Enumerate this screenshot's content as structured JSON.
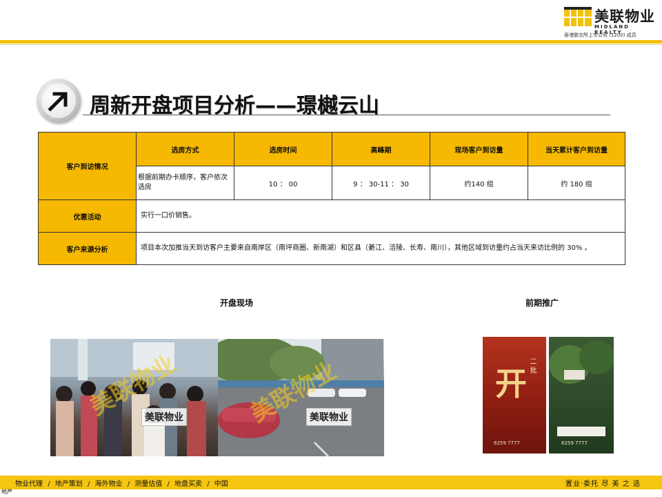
{
  "header": {
    "logo_cn": "美联物业",
    "logo_en": "MIDLAND REALTY",
    "logo_sub": "香港联交所上市公司 (1200) 成员",
    "brand_color": "#f6c510"
  },
  "title": "周新开盘项目分析——璟樾云山",
  "title_icon": "arrow-up-right-icon",
  "table": {
    "visits_label": "客户到访情况",
    "columns": [
      "选房方式",
      "选房时间",
      "高峰期",
      "现场客户到访量",
      "当天累计客户到访量"
    ],
    "values": [
      "根据前期办卡顺序，客户依次选房",
      "10 ： 00",
      "9 ： 30-11 ： 30",
      "约140 组",
      "约 180 组"
    ],
    "promo_label": "优惠活动",
    "promo_value": "实行一口价销售。",
    "source_label": "客户来源分析",
    "source_value": "项目本次加推当天到访客户主要来自南岸区（南坪商圈、新南湖）和区县（綦江、涪陵、长寿、南川），其他区域到访量约占当天来访比例的 30% 。"
  },
  "sections": {
    "opening_site": "开盘现场",
    "pre_promotion": "前期推广"
  },
  "photos": {
    "watermark": "美联物业",
    "poster_big_char": "开",
    "poster_side_text": "二 批",
    "poster_phone": "6259 7777"
  },
  "footer": {
    "nav": [
      "物业代理",
      "/",
      "地产策划",
      "/",
      "海外物业",
      "/",
      "测量估值",
      "/",
      "地盘买卖",
      "/",
      "中国"
    ],
    "slogan": "置业·委托  尽 美 之 选",
    "corner": "地产"
  }
}
